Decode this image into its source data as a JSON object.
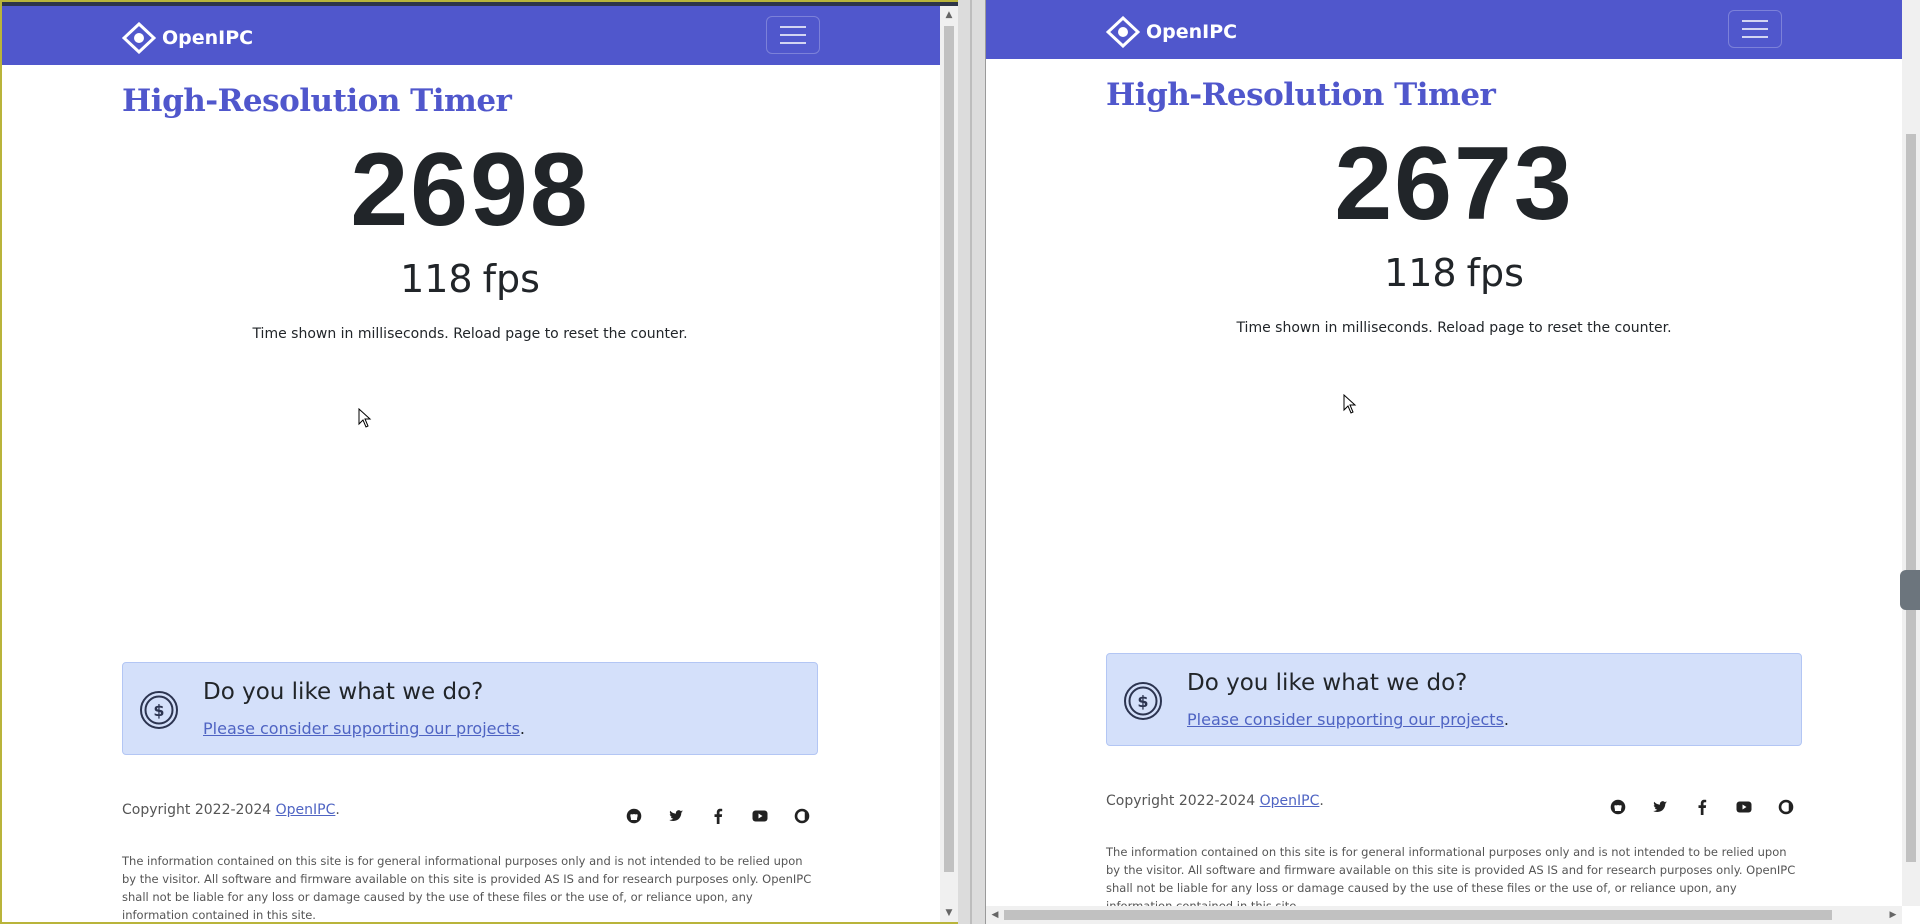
{
  "brand": {
    "name": "OpenIPC"
  },
  "colors": {
    "navbar": "#5057cc",
    "title": "#5057cc",
    "support_bg": "#d4e0fa",
    "link": "#4f64c3"
  },
  "left": {
    "title": "High-Resolution Timer",
    "counter": "2698",
    "fps_value": "118",
    "fps_unit": "fps",
    "note": "Time shown in milliseconds. Reload page to reset the counter.",
    "support_question": "Do you like what we do?",
    "support_link": "Please consider supporting our projects",
    "support_suffix": ".",
    "copyright_prefix": "Copyright 2022-2024",
    "copyright_link": "OpenIPC",
    "copyright_suffix": ".",
    "disclaimer": "The information contained on this site is for general informational purposes only and is not intended to be relied upon by the visitor. All software and firmware available on this site is provided AS IS and for research purposes only. OpenIPC shall not be liable for any loss or damage caused by the use of these files or the use of, or reliance upon, any information contained in this site."
  },
  "right": {
    "title": "High-Resolution Timer",
    "counter": "2673",
    "fps_value": "118",
    "fps_unit": "fps",
    "note": "Time shown in milliseconds. Reload page to reset the counter.",
    "support_question": "Do you like what we do?",
    "support_link": "Please consider supporting our projects",
    "support_suffix": ".",
    "copyright_prefix": "Copyright 2022-2024",
    "copyright_link": "OpenIPC",
    "copyright_suffix": ".",
    "disclaimer": "The information contained on this site is for general informational purposes only and is not intended to be relied upon by the visitor. All software and firmware available on this site is provided AS IS and for research purposes only. OpenIPC shall not be liable for any loss or damage caused by the use of these files or the use of, or reliance upon, any information contained in this site."
  },
  "social_icons": [
    "github-icon",
    "twitter-icon",
    "facebook-icon",
    "youtube-icon",
    "opencollective-icon"
  ]
}
